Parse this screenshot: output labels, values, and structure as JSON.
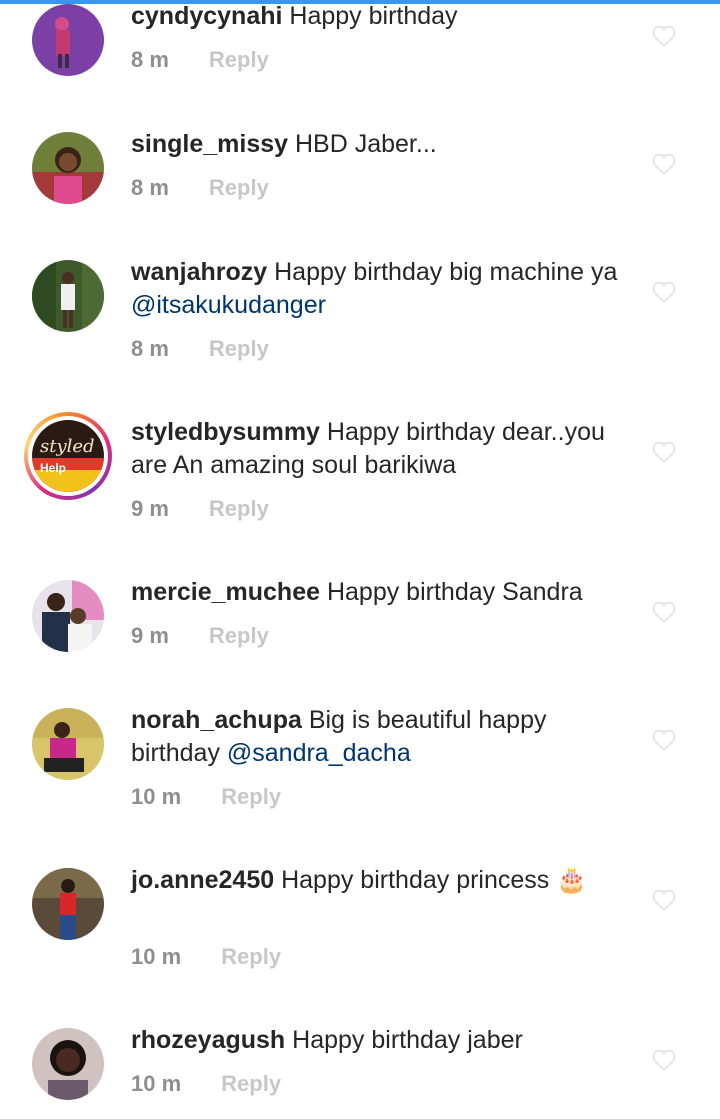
{
  "comments": [
    {
      "username": "cyndycynahi",
      "text": "Happy birthday",
      "mention": "",
      "text_after": "",
      "time": "8 m",
      "reply": "Reply",
      "avatar": "photo-purple"
    },
    {
      "username": "single_missy",
      "text": "HBD Jaber...",
      "mention": "",
      "text_after": "",
      "time": "8 m",
      "reply": "Reply",
      "avatar": "photo-woman-red"
    },
    {
      "username": "wanjahrozy",
      "text": "Happy birthday big machine ya ",
      "mention": "@itsakukudanger",
      "text_after": "",
      "time": "8 m",
      "reply": "Reply",
      "avatar": "photo-outdoor"
    },
    {
      "username": "styledbysummy",
      "text": "Happy birthday dear..you are An amazing soul barikiwa",
      "mention": "",
      "text_after": "",
      "time": "9 m",
      "reply": "Reply",
      "avatar": "logo-styled"
    },
    {
      "username": "mercie_muchee",
      "text": "Happy birthday Sandra",
      "mention": "",
      "text_after": "",
      "time": "9 m",
      "reply": "Reply",
      "avatar": "photo-group"
    },
    {
      "username": "norah_achupa",
      "text": "Big is beautiful happy birthday ",
      "mention": "@sandra_dacha",
      "text_after": "",
      "time": "10 m",
      "reply": "Reply",
      "avatar": "photo-sofa"
    },
    {
      "username": "jo.anne2450",
      "text": "Happy birthday princess",
      "mention": "",
      "text_after": "🎂",
      "time": "10 m",
      "reply": "Reply",
      "avatar": "photo-red-dress"
    },
    {
      "username": "rhozeyagush",
      "text": "Happy birthday jaber",
      "mention": "",
      "text_after": "",
      "time": "10 m",
      "reply": "Reply",
      "avatar": "photo-portrait"
    }
  ],
  "avatar_logo_text": {
    "styled": "styled",
    "help": "Help"
  },
  "colors": {
    "accent": "#3897f0",
    "mention": "#003569",
    "meta": "#8e8e8e",
    "reply": "#c7c7c7"
  },
  "icons": {
    "like": "heart-outline-icon"
  }
}
